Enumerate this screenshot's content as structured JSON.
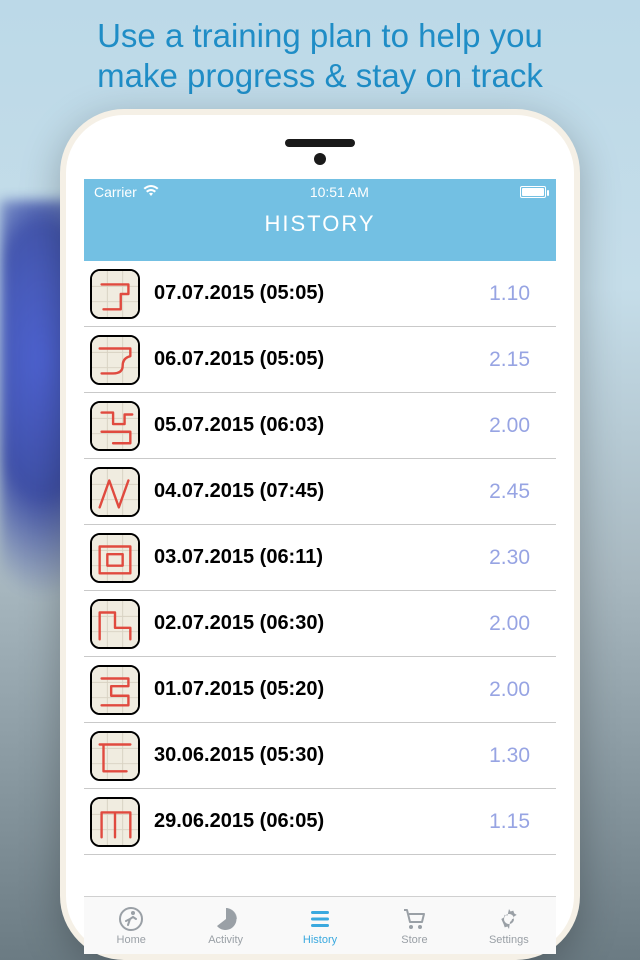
{
  "tagline_line1": "Use a training plan to help you",
  "tagline_line2": "make progress & stay on track",
  "status": {
    "carrier": "Carrier",
    "time": "10:51 AM"
  },
  "header": {
    "title": "HISTORY"
  },
  "history": [
    {
      "date": "07.07.2015 (05:05)",
      "distance": "1.10"
    },
    {
      "date": "06.07.2015 (05:05)",
      "distance": "2.15"
    },
    {
      "date": "05.07.2015 (06:03)",
      "distance": "2.00"
    },
    {
      "date": "04.07.2015 (07:45)",
      "distance": "2.45"
    },
    {
      "date": "03.07.2015 (06:11)",
      "distance": "2.30"
    },
    {
      "date": "02.07.2015 (06:30)",
      "distance": "2.00"
    },
    {
      "date": "01.07.2015 (05:20)",
      "distance": "2.00"
    },
    {
      "date": "30.06.2015 (05:30)",
      "distance": "1.30"
    },
    {
      "date": "29.06.2015 (06:05)",
      "distance": "1.15"
    }
  ],
  "tabs": [
    {
      "label": "Home"
    },
    {
      "label": "Activity"
    },
    {
      "label": "History"
    },
    {
      "label": "Store"
    },
    {
      "label": "Settings"
    }
  ],
  "active_tab": 2
}
